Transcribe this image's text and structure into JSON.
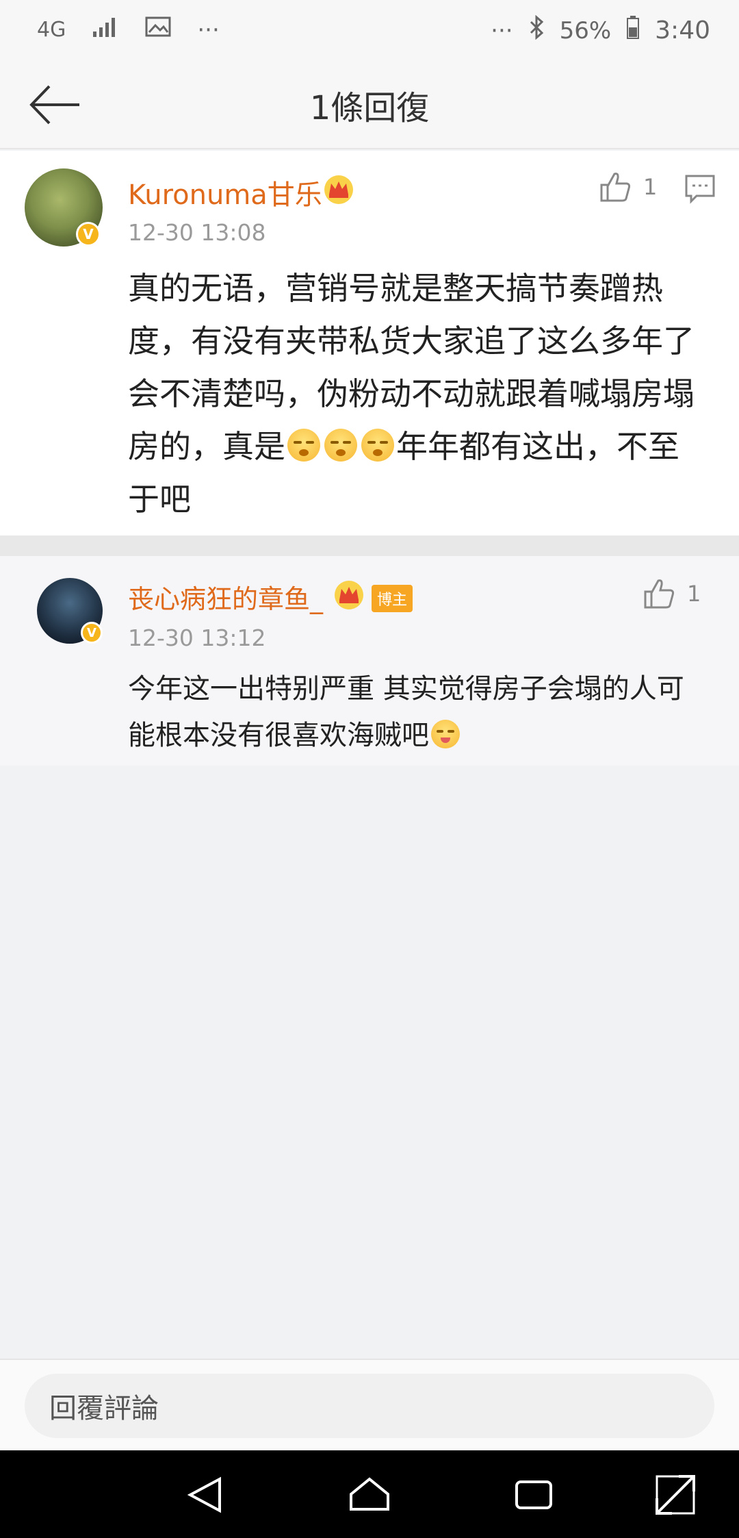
{
  "status_bar": {
    "network": "4G",
    "battery": "56%",
    "time": "3:40",
    "dots": "···"
  },
  "header": {
    "title": "1條回復"
  },
  "main_comment": {
    "username": "Kuronuma甘乐",
    "timestamp": "12-30 13:08",
    "text_parts": [
      "真的无语，营销号就是整天搞节奏蹭热度，有没有夹带私货大家追了这么多年了会不清楚吗，伪粉动不动就跟着喊塌房塌房的，真是",
      "年年都有这出，不至于吧"
    ],
    "likes": "1"
  },
  "reply_comment": {
    "username": "丧心病狂的章鱼_",
    "badge": "博主",
    "timestamp": "12-30 13:12",
    "text": "今年这一出特别严重 其实觉得房子会塌的人可能根本没有很喜欢海贼吧",
    "likes": "1"
  },
  "input": {
    "placeholder": "回覆評論"
  },
  "colors": {
    "accent": "#e06a1b",
    "badge": "#f6a623",
    "verified": "#f7b51c"
  }
}
